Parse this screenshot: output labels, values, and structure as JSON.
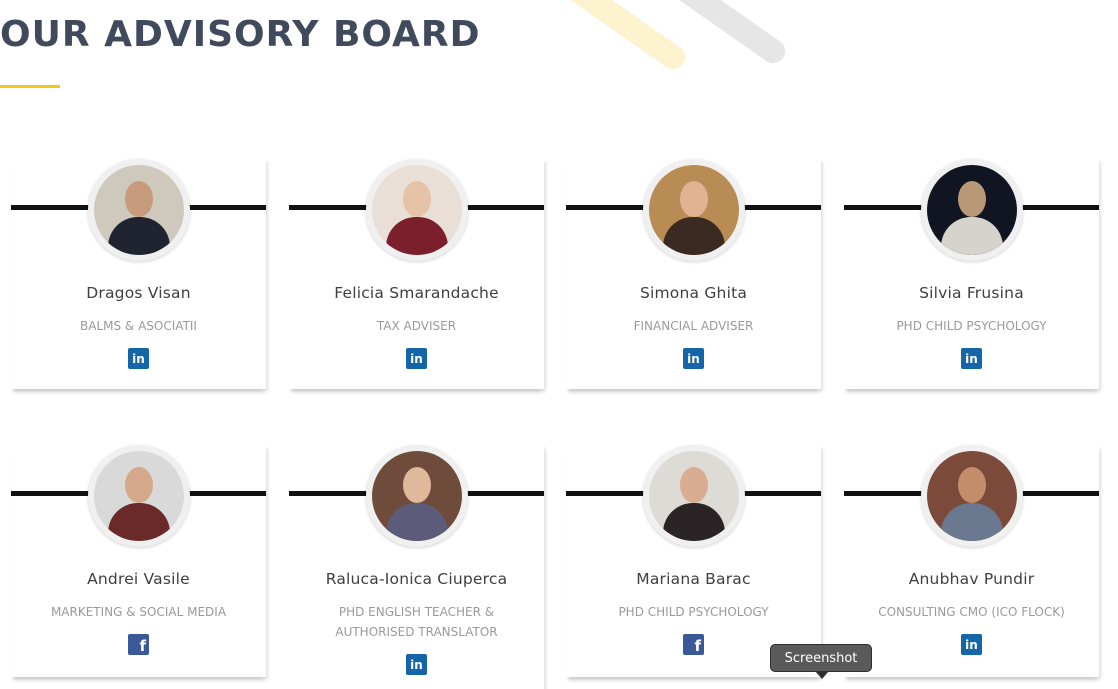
{
  "section": {
    "title": "OUR ADVISORY BOARD",
    "accent": "#f5c518"
  },
  "tooltip": {
    "text": "Screenshot"
  },
  "members": [
    {
      "name": "Dragos Visan",
      "role": "BALMS & ASOCIATII",
      "social": "linkedin-icon",
      "photo": {
        "bg": "#cfc8bd",
        "skin": "#c79a7c",
        "clothes": "#1f2430"
      }
    },
    {
      "name": "Felicia Smarandache",
      "role": "TAX ADVISER",
      "social": "linkedin-icon",
      "photo": {
        "bg": "#e9dfd7",
        "skin": "#e6c2a6",
        "clothes": "#7a1f2b"
      }
    },
    {
      "name": "Simona Ghita",
      "role": "FINANCIAL ADVISER",
      "social": "linkedin-icon",
      "photo": {
        "bg": "#b98b55",
        "skin": "#e2b293",
        "clothes": "#3a2a22"
      }
    },
    {
      "name": "Silvia Frusina",
      "role": "PHD CHILD PSYCHOLOGY",
      "social": "linkedin-icon",
      "photo": {
        "bg": "#111522",
        "skin": "#b89877",
        "clothes": "#d6d2cc"
      }
    },
    {
      "name": "Andrei Vasile",
      "role": "MARKETING & SOCIAL MEDIA",
      "social": "facebook-icon",
      "photo": {
        "bg": "#d9d9d9",
        "skin": "#d6a88b",
        "clothes": "#6b2a2a"
      }
    },
    {
      "name": "Raluca-Ionica Ciuperca",
      "role": "PHD ENGLISH TEACHER & AUTHORISED TRANSLATOR",
      "social": "linkedin-icon",
      "photo": {
        "bg": "#6e4b3a",
        "skin": "#e0b89b",
        "clothes": "#5d5b7a"
      }
    },
    {
      "name": "Mariana Barac",
      "role": "PHD CHILD PSYCHOLOGY",
      "social": "facebook-icon",
      "photo": {
        "bg": "#dedad5",
        "skin": "#d9ad91",
        "clothes": "#2a2426"
      }
    },
    {
      "name": "Anubhav Pundir",
      "role": "CONSULTING CMO (ICO FLOCK)",
      "social": "linkedin-icon",
      "photo": {
        "bg": "#7b4a3a",
        "skin": "#c38d6a",
        "clothes": "#6a7890"
      }
    }
  ]
}
